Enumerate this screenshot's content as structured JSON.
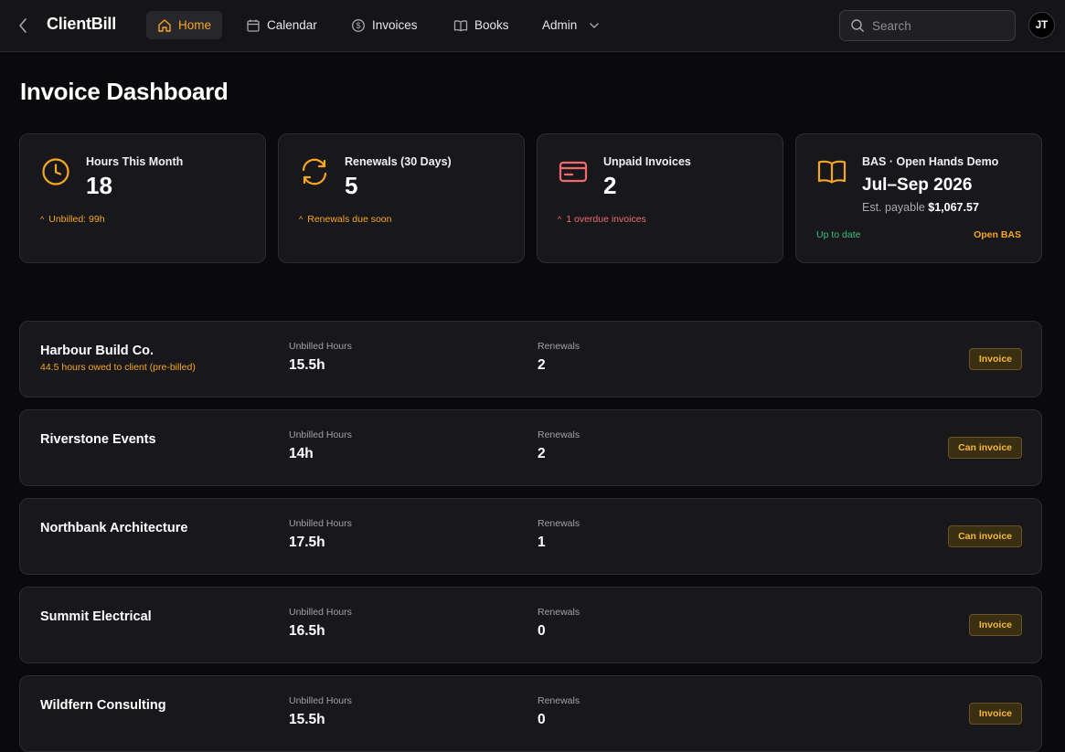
{
  "app": {
    "brand": "ClientBill"
  },
  "nav": {
    "home": "Home",
    "calendar": "Calendar",
    "invoices": "Invoices",
    "books": "Books",
    "admin": "Admin"
  },
  "search": {
    "placeholder": "Search"
  },
  "user": {
    "initials": "JT"
  },
  "page": {
    "title": "Invoice Dashboard"
  },
  "stats": {
    "hours": {
      "label": "Hours This Month",
      "value": "18",
      "note": "Unbilled: 99h"
    },
    "renewals": {
      "label": "Renewals (30 Days)",
      "value": "5",
      "note": "Renewals due soon"
    },
    "unpaid": {
      "label": "Unpaid Invoices",
      "value": "2",
      "note": "1 overdue invoices"
    },
    "bas": {
      "label": "BAS · Open Hands Demo",
      "period": "Jul–Sep 2026",
      "est_label": "Est. payable",
      "est_value": "$1,067.57",
      "status": "Up to date",
      "action": "Open BAS"
    }
  },
  "columns": {
    "hours": "Unbilled Hours",
    "renewals": "Renewals"
  },
  "clients": [
    {
      "name": "Harbour Build Co.",
      "sub": "44.5 hours owed to client (pre-billed)",
      "hours": "15.5h",
      "renewals": "2",
      "action": "Invoice"
    },
    {
      "name": "Riverstone Events",
      "sub": "",
      "hours": "14h",
      "renewals": "2",
      "action": "Can invoice"
    },
    {
      "name": "Northbank Architecture",
      "sub": "",
      "hours": "17.5h",
      "renewals": "1",
      "action": "Can invoice"
    },
    {
      "name": "Summit Electrical",
      "sub": "",
      "hours": "16.5h",
      "renewals": "0",
      "action": "Invoice"
    },
    {
      "name": "Wildfern Consulting",
      "sub": "",
      "hours": "15.5h",
      "renewals": "0",
      "action": "Invoice"
    }
  ],
  "colors": {
    "accent": "#f5a623",
    "danger": "#f06a6a",
    "success": "#3fbf7f",
    "card": "#18181c",
    "background": "#0a0a0c"
  },
  "icons": {
    "back": "chevron-left-icon",
    "home": "home-icon",
    "calendar": "calendar-icon",
    "invoices": "dollar-circle-icon",
    "books": "book-icon",
    "admin": "chevron-down-icon",
    "search": "search-icon",
    "hours": "clock-icon",
    "renewals": "refresh-icon",
    "unpaid": "credit-card-icon",
    "bas": "book-open-icon"
  }
}
